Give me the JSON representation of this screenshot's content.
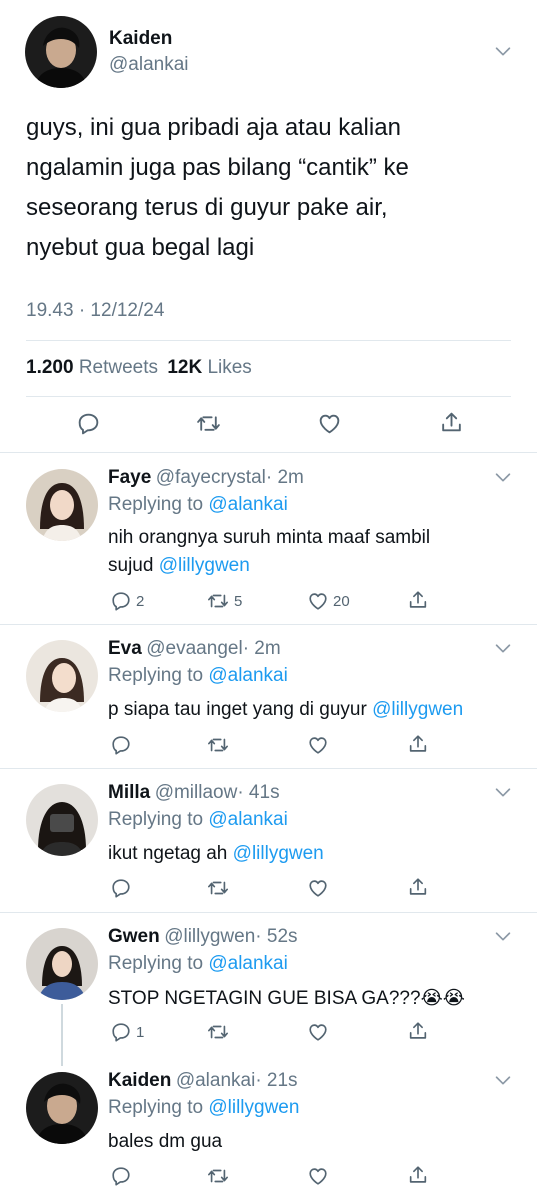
{
  "main_tweet": {
    "name": "Kaiden",
    "handle": "@alankai",
    "text_lines": [
      "guys, ini gua pribadi aja atau kalian",
      "ngalamin juga pas bilang “cantik” ke",
      "seseorang terus di guyur pake air,",
      "nyebut gua begal lagi"
    ],
    "timestamp": "19.43 · 12/12/24",
    "retweets_count": "1.200",
    "retweets_label": "Retweets",
    "likes_count": "12K",
    "likes_label": "Likes"
  },
  "replies": [
    {
      "name": "Faye",
      "handle": "@fayecrystal",
      "time": "· 2m",
      "replying_prefix": "Replying to",
      "replying_to": "@alankai",
      "text_parts": [
        "nih orangnya suruh minta maaf sambil",
        "sujud "
      ],
      "mention": "@lillygwen",
      "reply_count": "2",
      "retweet_count": "5",
      "like_count": "20"
    },
    {
      "name": "Eva",
      "handle": "@evaangel",
      "time": "· 2m",
      "replying_prefix": "Replying to",
      "replying_to": "@alankai",
      "text": "p siapa tau inget yang di guyur ",
      "mention": "@lillygwen"
    },
    {
      "name": "Milla",
      "handle": "@millaow",
      "time": "· 41s",
      "replying_prefix": "Replying to",
      "replying_to": "@alankai",
      "text": "ikut ngetag ah ",
      "mention": "@lillygwen"
    },
    {
      "name": "Gwen",
      "handle": "@lillygwen",
      "time": "· 52s",
      "replying_prefix": "Replying to",
      "replying_to": "@alankai",
      "text": "STOP NGETAGIN GUE BISA GA???",
      "emoji": "😭😭",
      "reply_count": "1"
    },
    {
      "name": "Kaiden",
      "handle": "@alankai",
      "time": "· 21s",
      "replying_prefix": "Replying to",
      "replying_to": "@lillygwen",
      "text": "bales dm gua"
    }
  ],
  "colors": {
    "link": "#1d9bf0",
    "gray": "#657786",
    "divider": "#e1e8ed"
  }
}
